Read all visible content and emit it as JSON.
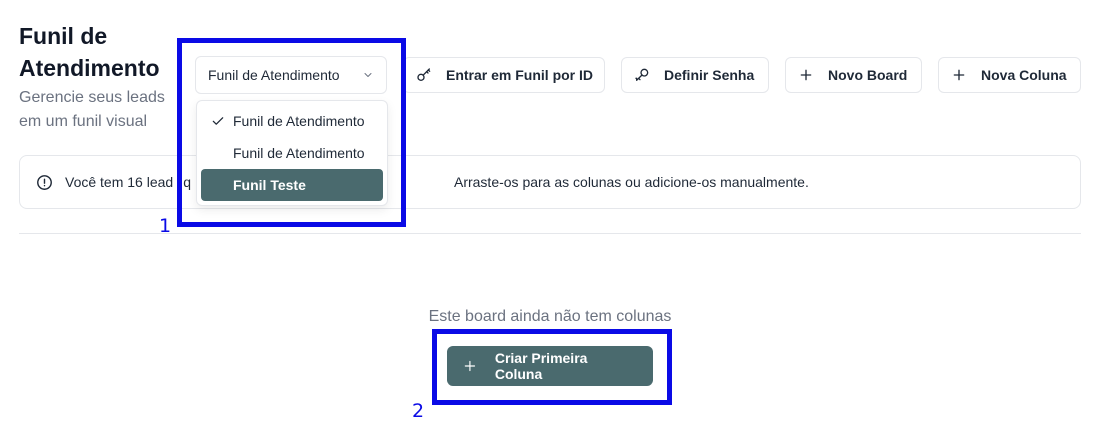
{
  "header": {
    "title": "Funil de Atendimento",
    "subtitle": "Gerencie seus leads em um funil visual"
  },
  "board_select": {
    "selected": "Funil de Atendimento",
    "options": [
      {
        "label": "Funil de Atendimento",
        "checked": true,
        "highlighted": false
      },
      {
        "label": "Funil de Atendimento",
        "checked": false,
        "highlighted": false
      },
      {
        "label": "Funil Teste",
        "checked": false,
        "highlighted": true
      }
    ]
  },
  "toolbar": {
    "enter_funnel_label": "Entrar em Funil por ID",
    "set_password_label": "Definir Senha",
    "new_board_label": "Novo Board",
    "new_column_label": "Nova Coluna"
  },
  "alert": {
    "text_before": "Você tem 16 lead",
    "text_mid": "q",
    "text_after": "Arraste-os para as colunas ou adicione-os manualmente."
  },
  "empty_state": {
    "text": "Este board ainda não tem colunas",
    "button_label": "Criar Primeira Coluna"
  },
  "annotations": {
    "label_1": "1",
    "label_2": "2",
    "color": "#0a0ae6"
  },
  "colors": {
    "primary": "#4a6a6e",
    "border": "#e5e7eb",
    "muted_text": "#6b7280"
  }
}
